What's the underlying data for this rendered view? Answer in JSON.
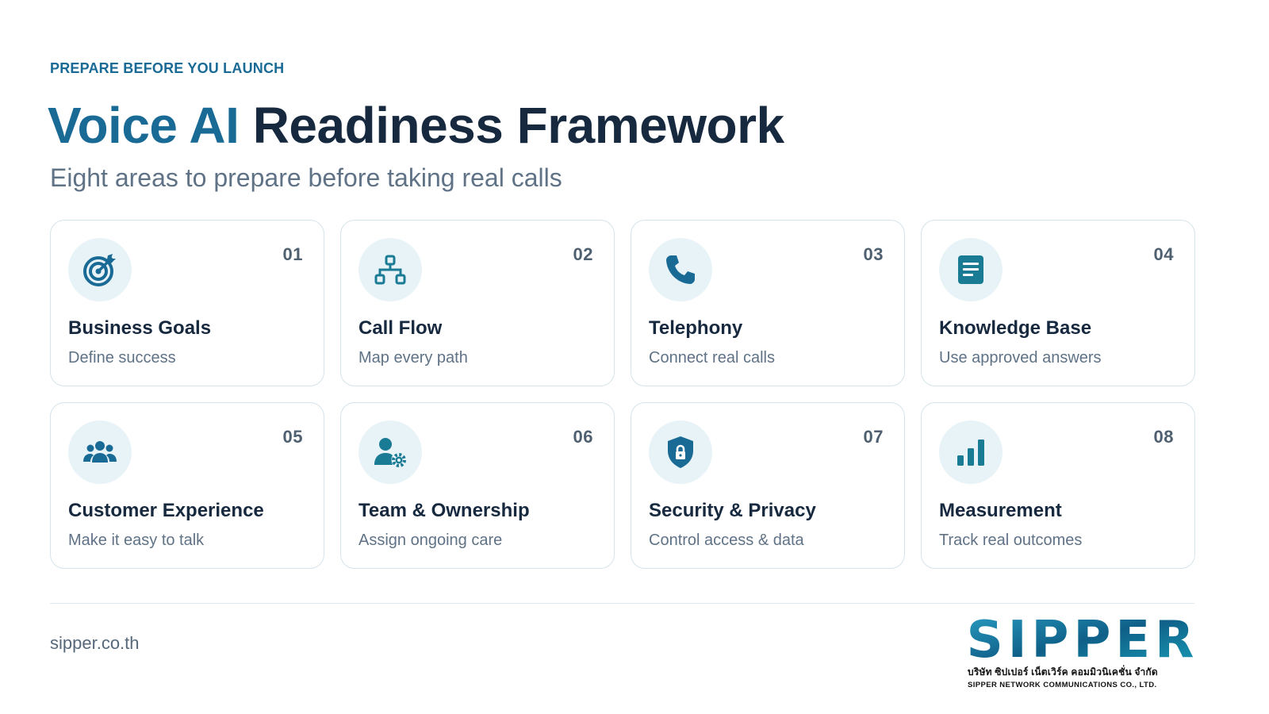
{
  "header": {
    "eyebrow": "PREPARE BEFORE YOU LAUNCH",
    "title_accent": "Voice AI",
    "title_rest": "Readiness Framework",
    "subtitle": "Eight areas to prepare before taking real calls"
  },
  "cards": [
    {
      "num": "01",
      "title": "Business Goals",
      "desc": "Define success",
      "icon": "target-icon"
    },
    {
      "num": "02",
      "title": "Call Flow",
      "desc": "Map every path",
      "icon": "flowchart-icon"
    },
    {
      "num": "03",
      "title": "Telephony",
      "desc": "Connect real calls",
      "icon": "phone-icon"
    },
    {
      "num": "04",
      "title": "Knowledge Base",
      "desc": "Use approved answers",
      "icon": "document-icon"
    },
    {
      "num": "05",
      "title": "Customer Experience",
      "desc": "Make it easy to talk",
      "icon": "users-icon"
    },
    {
      "num": "06",
      "title": "Team & Ownership",
      "desc": "Assign ongoing care",
      "icon": "user-gear-icon"
    },
    {
      "num": "07",
      "title": "Security & Privacy",
      "desc": "Control access & data",
      "icon": "shield-lock-icon"
    },
    {
      "num": "08",
      "title": "Measurement",
      "desc": "Track real outcomes",
      "icon": "bar-chart-icon"
    }
  ],
  "footer": {
    "website": "sipper.co.th",
    "logo_text": "SIPPER",
    "logo_thai": "บริษัท ซิปเปอร์ เน็ตเวิร์ค คอมมิวนิเคชั่น จำกัด",
    "logo_english": "SIPPER NETWORK COMMUNICATIONS CO., LTD."
  },
  "colors": {
    "accent": "#1a6a96",
    "dark": "#17293f",
    "icon_teal": "#1a7b95",
    "card_border": "#d5e3ea",
    "icon_bg": "#e8f3f8"
  }
}
